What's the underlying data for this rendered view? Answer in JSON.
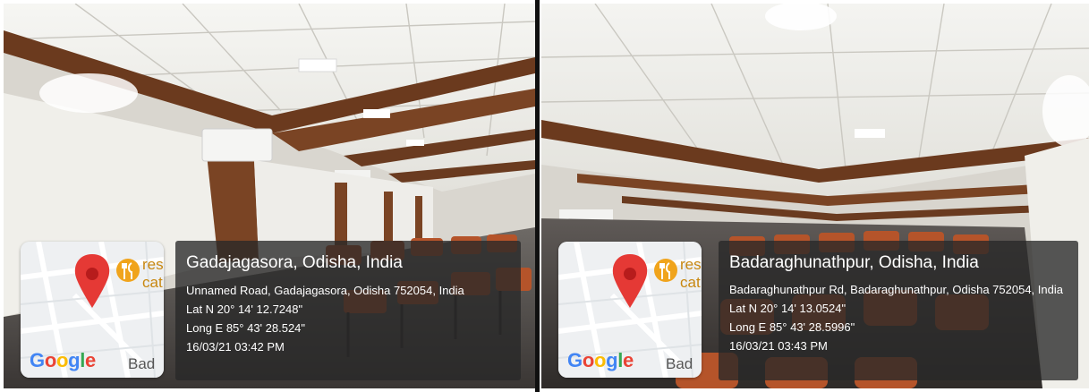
{
  "photos": [
    {
      "location_title": "Gadajagasora, Odisha, India",
      "address": "Unnamed Road, Gadajagasora, Odisha 752054, India",
      "latitude": "Lat N 20° 14' 12.7248\"",
      "longitude": "Long E 85° 43' 28.524\"",
      "datetime": "16/03/21 03:42 PM",
      "map": {
        "poi_label": "res\ncat",
        "area_label": "Bad",
        "logo_letters": [
          "G",
          "o",
          "o",
          "g",
          "l",
          "e"
        ],
        "pin_icon": "map-pin-icon",
        "poi_icon": "restaurant-icon"
      }
    },
    {
      "location_title": "Badaraghunathpur, Odisha, India",
      "address": "Badaraghunathpur Rd, Badaraghunathpur, Odisha 752054, India",
      "latitude": "Lat N 20° 14' 13.0524\"",
      "longitude": "Long E 85° 43' 28.5996\"",
      "datetime": "16/03/21 03:43 PM",
      "map": {
        "poi_label": "res\ncat",
        "area_label": "Bad",
        "logo_letters": [
          "G",
          "o",
          "o",
          "g",
          "l",
          "e"
        ],
        "pin_icon": "map-pin-icon",
        "poi_icon": "restaurant-icon"
      }
    }
  ],
  "colors": {
    "pin": "#e53935",
    "poi": "#f0a41c",
    "ceiling": "#f2f2ee",
    "wood": "#6b3a1e",
    "chair": "#b5542a"
  }
}
